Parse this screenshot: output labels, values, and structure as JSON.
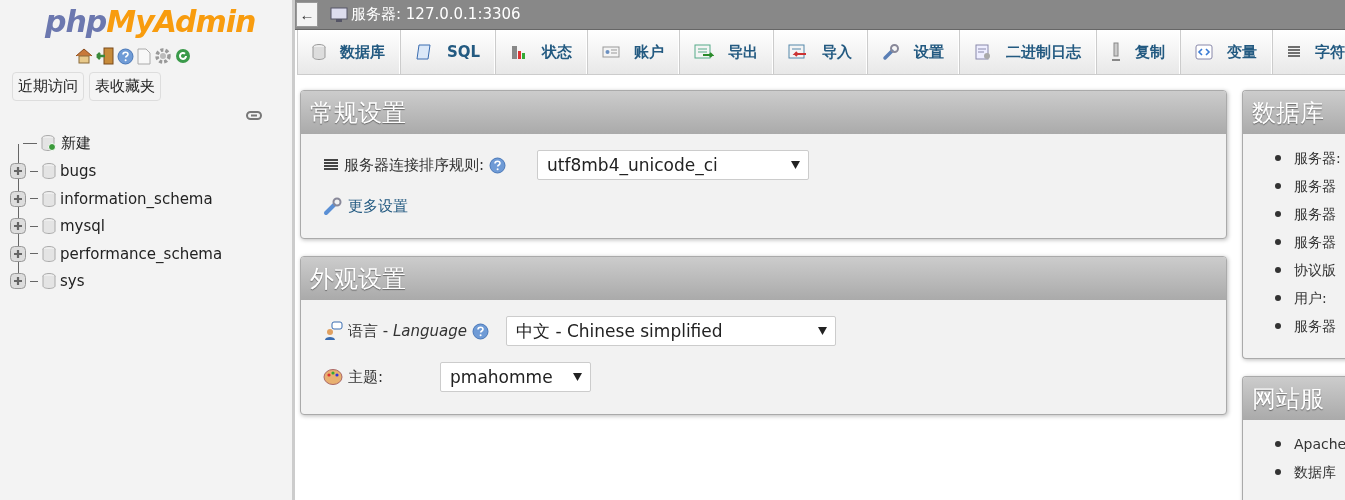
{
  "sidebar": {
    "logo": {
      "prefix": "php",
      "name": "MyAdmin"
    },
    "buttons": [
      "近期访问",
      "表收藏夹"
    ],
    "tree": [
      {
        "label": "新建",
        "kind": "new"
      },
      {
        "label": "bugs",
        "kind": "db",
        "expanded": false
      },
      {
        "label": "information_schema",
        "kind": "db",
        "expanded": false
      },
      {
        "label": "mysql",
        "kind": "db",
        "expanded": false
      },
      {
        "label": "performance_schema",
        "kind": "db",
        "expanded": false
      },
      {
        "label": "sys",
        "kind": "db",
        "expanded": false
      }
    ]
  },
  "server_bar": {
    "back": "←",
    "title": "服务器: 127.0.0.1:3306"
  },
  "tabs": [
    {
      "label": "数据库",
      "selected": false
    },
    {
      "label": "SQL",
      "selected": false
    },
    {
      "label": "状态",
      "selected": false
    },
    {
      "label": "账户",
      "selected": false
    },
    {
      "label": "导出",
      "selected": false
    },
    {
      "label": "导入",
      "selected": false
    },
    {
      "label": "设置",
      "selected": false
    },
    {
      "label": "二进制日志",
      "selected": false
    },
    {
      "label": "复制",
      "selected": false
    },
    {
      "label": "变量",
      "selected": false
    },
    {
      "label": "字符",
      "selected": false
    }
  ],
  "panels": [
    {
      "title": "常规设置",
      "rows": [
        {
          "kind": "select",
          "label": "服务器连接排序规则:",
          "help": true,
          "value": "utf8mb4_unicode_ci"
        },
        {
          "kind": "link",
          "label": "更多设置"
        }
      ]
    },
    {
      "title": "外观设置",
      "rows": [
        {
          "kind": "select",
          "label": "语言 - *Language*",
          "help": true,
          "value": "中文 - Chinese simplified"
        },
        {
          "kind": "select",
          "label": "主题:",
          "help": false,
          "value": "pmahomme"
        }
      ]
    }
  ],
  "side_panels": [
    {
      "title": "数据库",
      "items": [
        "服务器:",
        "服务器",
        "服务器",
        "服务器",
        "协议版",
        "用户:",
        "服务器"
      ]
    },
    {
      "title": "网站服",
      "items": [
        "Apache",
        "数据库"
      ]
    }
  ]
}
